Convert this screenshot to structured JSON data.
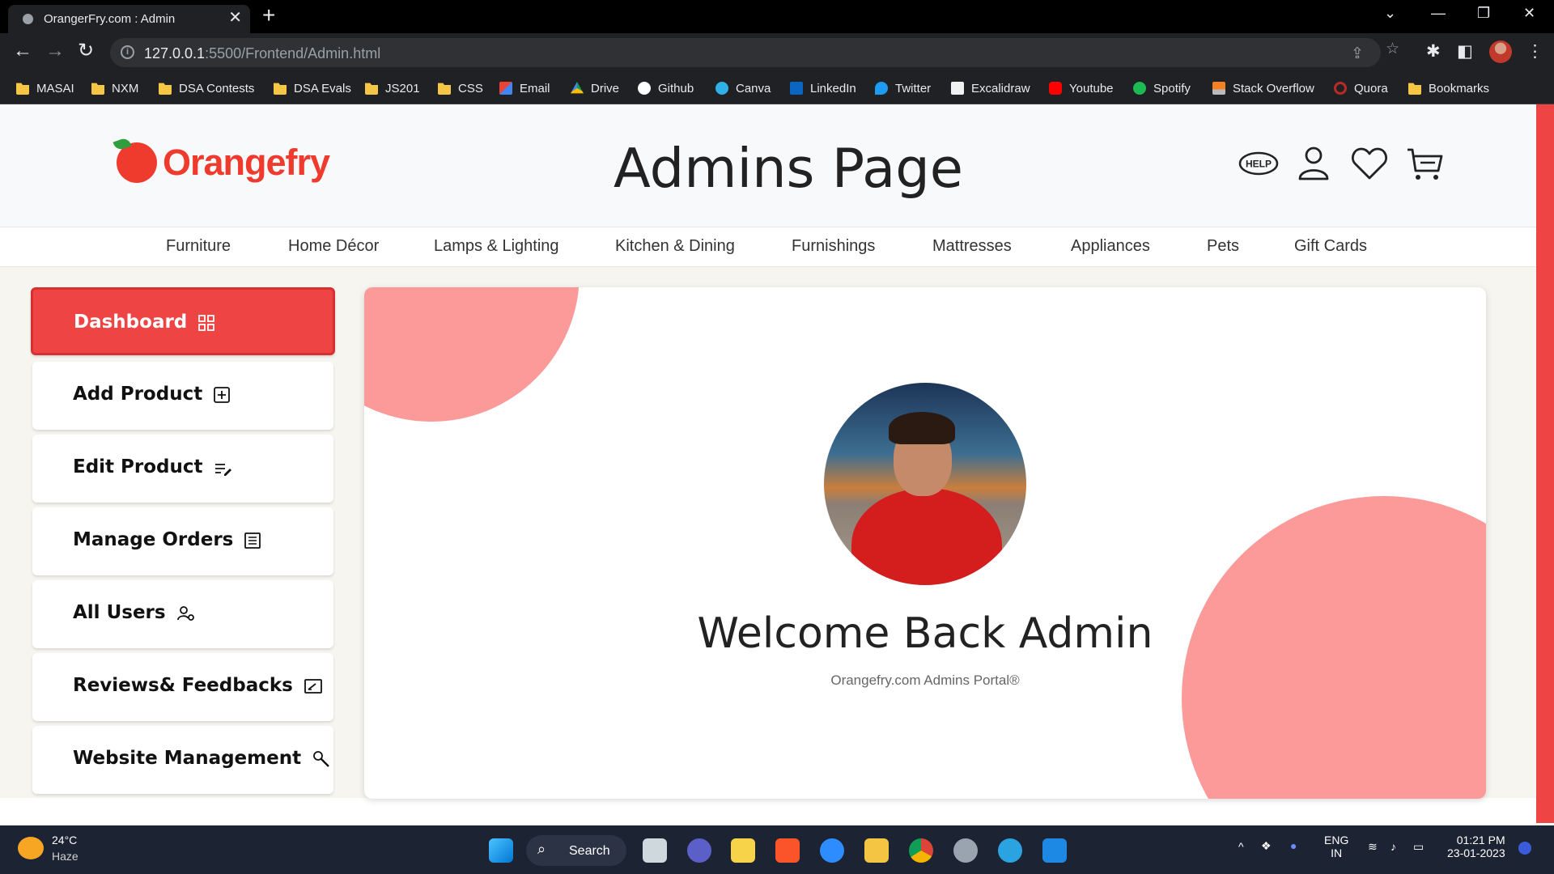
{
  "browser": {
    "tab_title": "OrangerFry.com : Admin",
    "url_host": "127.0.0.1",
    "url_path": ":5500/Frontend/Admin.html",
    "bookmarks": [
      {
        "label": "MASAI",
        "icon": "folder"
      },
      {
        "label": "NXM",
        "icon": "folder"
      },
      {
        "label": "DSA Contests",
        "icon": "folder"
      },
      {
        "label": "DSA Evals",
        "icon": "folder"
      },
      {
        "label": "JS201",
        "icon": "folder"
      },
      {
        "label": "CSS",
        "icon": "folder"
      },
      {
        "label": "Email",
        "icon": "gmail-icon"
      },
      {
        "label": "Drive",
        "icon": "drive-icon"
      },
      {
        "label": "Github",
        "icon": "github-icon"
      },
      {
        "label": "Canva",
        "icon": "canva-icon"
      },
      {
        "label": "LinkedIn",
        "icon": "linkedin-icon"
      },
      {
        "label": "Twitter",
        "icon": "twitter-icon"
      },
      {
        "label": "Excalidraw",
        "icon": "excalidraw-icon"
      },
      {
        "label": "Youtube",
        "icon": "youtube-icon"
      },
      {
        "label": "Spotify",
        "icon": "spotify-icon"
      },
      {
        "label": "Stack Overflow",
        "icon": "stackoverflow-icon"
      },
      {
        "label": "Quora",
        "icon": "quora-icon"
      },
      {
        "label": "Bookmarks",
        "icon": "folder"
      }
    ]
  },
  "site": {
    "logo_text": "Orangefry",
    "page_title": "Admins Page",
    "help_label": "HELP",
    "categories": [
      "Furniture",
      "Home Décor",
      "Lamps & Lighting",
      "Kitchen & Dining",
      "Furnishings",
      "Mattresses",
      "Appliances",
      "Pets",
      "Gift Cards"
    ]
  },
  "sidebar": {
    "items": [
      {
        "label": "Dashboard",
        "icon": "grid-icon",
        "active": true
      },
      {
        "label": "Add Product",
        "icon": "plus-square-icon",
        "active": false
      },
      {
        "label": "Edit Product",
        "icon": "edit-list-icon",
        "active": false
      },
      {
        "label": "Manage Orders",
        "icon": "list-icon",
        "active": false
      },
      {
        "label": "All Users",
        "icon": "user-settings-icon",
        "active": false
      },
      {
        "label": "Reviews& Feedbacks",
        "icon": "feedback-icon",
        "active": false
      },
      {
        "label": "Website Management",
        "icon": "wrench-icon",
        "active": false
      }
    ]
  },
  "welcome": {
    "heading": "Welcome Back Admin",
    "subtitle": "Orangefry.com Admins Portal®"
  },
  "colors": {
    "accent": "#ef4444",
    "blob": "#fc9a9a",
    "logo": "#ef3b2d"
  },
  "taskbar": {
    "temperature": "24°C",
    "condition": "Haze",
    "search_label": "Search",
    "language": "ENG",
    "region": "IN",
    "time": "01:21 PM",
    "date": "23-01-2023"
  }
}
